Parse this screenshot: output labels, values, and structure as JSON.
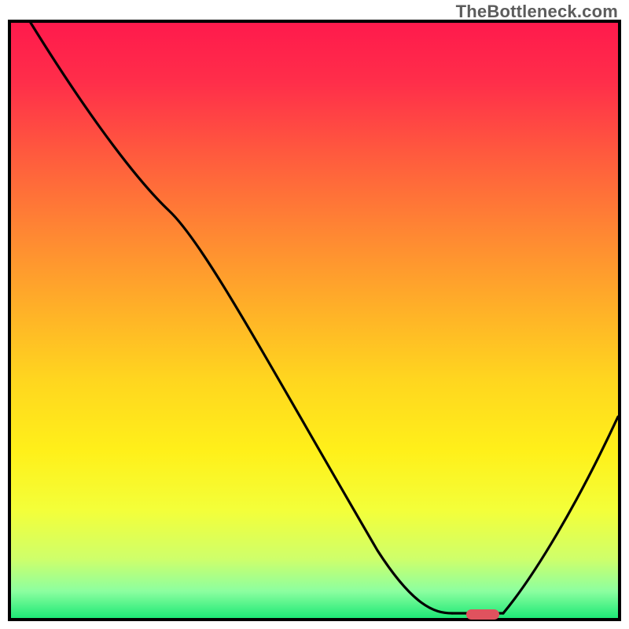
{
  "watermark": "TheBottleneck.com",
  "colors": {
    "gradient_top": "#ff1a4c",
    "gradient_bottom": "#1ee876",
    "curve": "#000000",
    "marker": "#e0525e",
    "frame": "#000000"
  },
  "chart_data": {
    "type": "line",
    "title": "",
    "xlabel": "",
    "ylabel": "",
    "xlim": [
      0,
      100
    ],
    "ylim": [
      0,
      100
    ],
    "grid": false,
    "legend": false,
    "note": "Bottleneck curve; gradient background encodes bottleneck % from red (high) at top to green (low) at bottom. Axis units not labeled in source image — values are relative 0-100.",
    "series": [
      {
        "name": "bottleneck-curve",
        "x": [
          3,
          12,
          20,
          26,
          34,
          45,
          55,
          62,
          70,
          74,
          78,
          81,
          85,
          92,
          100
        ],
        "values": [
          100,
          82,
          70,
          65,
          55,
          40,
          25,
          15,
          6,
          2,
          0,
          0,
          3,
          18,
          33
        ]
      }
    ],
    "annotations": [
      {
        "name": "sweet-spot",
        "x_range": [
          76,
          81
        ],
        "y": 0,
        "color": "#e0525e",
        "shape": "pill"
      }
    ]
  }
}
